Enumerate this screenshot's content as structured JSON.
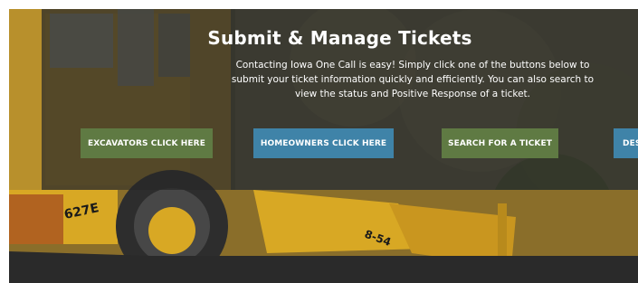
{
  "hero": {
    "title": "Submit & Manage Tickets",
    "description": "Contacting Iowa One Call is easy! Simply click one of the buttons below to submit your ticket information quickly and efficiently. You can also search to view the status and Positive Response of a ticket."
  },
  "buttons": {
    "excavators": "EXCAVATORS CLICK HERE",
    "homeowners": "HOMEOWNERS CLICK HERE",
    "search": "SEARCH FOR A TICKET",
    "designers": "DES"
  },
  "machine": {
    "cab_label": "627E",
    "arm_label": "8-54"
  },
  "colors": {
    "green_button": "#5f7a43",
    "blue_button": "#3f83a8",
    "overlay": "#282828",
    "machine_yellow": "#d8a824"
  }
}
